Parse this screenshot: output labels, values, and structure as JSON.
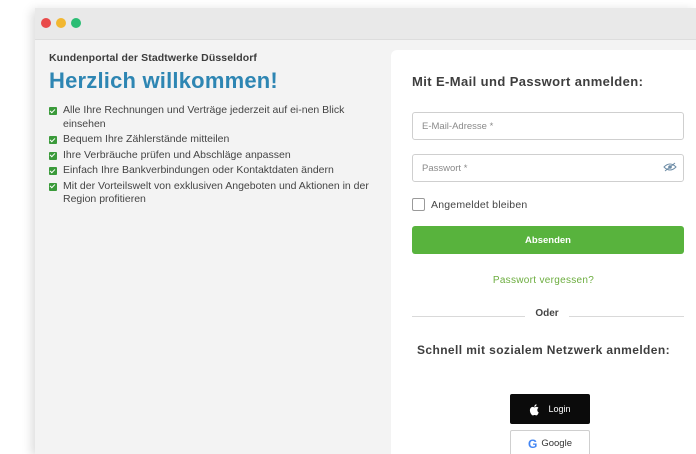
{
  "window": {
    "controls": [
      "close",
      "minimize",
      "maximize"
    ]
  },
  "intro": {
    "subtitle": "Kundenportal der Stadtwerke Düsseldorf",
    "heading": "Herzlich willkommen!",
    "features": [
      "Alle Ihre Rechnungen und Verträge jederzeit auf ei-nen Blick einsehen",
      "Bequem Ihre Zählerstände mitteilen",
      "Ihre Verbräuche prüfen und Abschläge anpassen",
      "Einfach Ihre Bankverbindungen oder Kontaktdaten ändern",
      "Mit der Vorteilswelt von exklusiven Angeboten und Aktionen in der Region profitieren"
    ]
  },
  "login": {
    "title": "Mit E-Mail und Passwort anmelden:",
    "email_placeholder": "E-Mail-Adresse *",
    "password_placeholder": "Passwort *",
    "remember_label": "Angemeldet bleiben",
    "submit_label": "Absenden",
    "forgot_label": "Passwort vergessen?",
    "divider_label": "Oder",
    "social_title": "Schnell mit sozialem Netzwerk anmelden:",
    "apple_label": "Login",
    "google_label": "Google"
  },
  "colors": {
    "heading": "#2e86b3",
    "primary_button": "#58b33d",
    "link": "#6cad3f",
    "check": "#3a9a3a",
    "close_dot": "#e94a4a",
    "minimize_dot": "#f2b731",
    "maximize_dot": "#2bbd74"
  },
  "icons": {
    "feature_bullet": "check-square-icon",
    "password_toggle": "eye-slash-icon",
    "apple": "apple-icon",
    "google": "google-g-icon"
  }
}
